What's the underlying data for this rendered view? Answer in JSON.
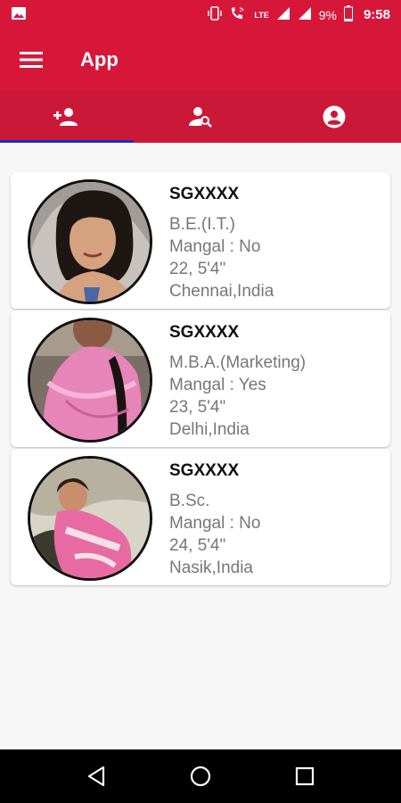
{
  "status_bar": {
    "network": "LTE",
    "battery": "9%",
    "time": "9:58"
  },
  "app_bar": {
    "title": "App"
  },
  "tabs": [
    {
      "icon": "people-icon",
      "selected": true
    },
    {
      "icon": "person-search-icon",
      "selected": false
    },
    {
      "icon": "account-circle-icon",
      "selected": false
    }
  ],
  "profiles": [
    {
      "id": "SGXXXX",
      "education": "B.E.(I.T.)",
      "mangal": "Mangal : No",
      "age_height": "22, 5'4\"",
      "location": "Chennai,India"
    },
    {
      "id": "SGXXXX",
      "education": "M.B.A.(Marketing)",
      "mangal": "Mangal : Yes",
      "age_height": "23, 5'4\"",
      "location": " Delhi,India"
    },
    {
      "id": "SGXXXX",
      "education": "B.Sc.",
      "mangal": "Mangal : No",
      "age_height": "24, 5'4\"",
      "location": " Nasik,India"
    }
  ],
  "colors": {
    "primary": "#d7173a",
    "tab_background": "#cc1838",
    "tab_indicator": "#1a2bb8"
  }
}
